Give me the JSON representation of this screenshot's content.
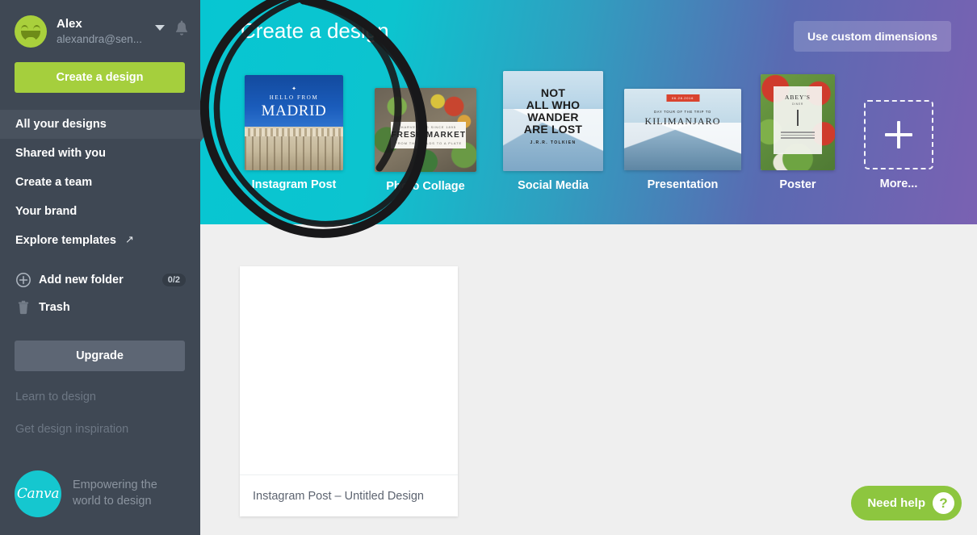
{
  "sidebar": {
    "account": {
      "name": "Alex",
      "email": "alexandra@sen...",
      "avatar_icon": "smiley-face-avatar",
      "caret_icon": "chevron-down-icon",
      "bell_icon": "bell-icon"
    },
    "create_design_label": "Create a design",
    "nav_items": [
      {
        "label": "All your designs",
        "active": true
      },
      {
        "label": "Shared with you",
        "active": false
      },
      {
        "label": "Create a team",
        "active": false
      },
      {
        "label": "Your brand",
        "active": false
      },
      {
        "label": "Explore templates",
        "active": false,
        "external_icon": "↗"
      }
    ],
    "folders": [
      {
        "label": "Add new folder",
        "icon": "plus-circle-icon",
        "badge": "0/2"
      },
      {
        "label": "Trash",
        "icon": "trash-icon",
        "badge": ""
      }
    ],
    "upgrade_label": "Upgrade",
    "faint_links": [
      {
        "label": "Learn to design"
      },
      {
        "label": "Get design inspiration"
      }
    ],
    "brand": {
      "logo_text": "Canva",
      "tagline_line1": "Empowering the",
      "tagline_line2": "world to design"
    }
  },
  "header": {
    "title": "Create a design",
    "custom_dimensions_label": "Use custom dimensions",
    "templates": [
      {
        "label": "Instagram Post",
        "art": "madrid"
      },
      {
        "label": "Photo Collage",
        "art": "fresh-market"
      },
      {
        "label": "Social Media",
        "art": "not-all-who-wander"
      },
      {
        "label": "Presentation",
        "art": "kilimanjaro"
      },
      {
        "label": "Poster",
        "art": "abeys"
      },
      {
        "label": "More...",
        "art": "more-plus"
      }
    ],
    "template_art_text": {
      "madrid": {
        "hello": "HELLO FROM",
        "title": "MADRID"
      },
      "fresh_market": {
        "top": "HARVESTING SINCE 1895",
        "title": "FRESH MARKET",
        "bottom": "FROM THE FIELDS TO A PLATE"
      },
      "wander": {
        "l1": "NOT",
        "l2": "ALL WHO",
        "l3": "WANDER",
        "l4": "ARE LOST",
        "by": "J.R.R. TOLKIEN"
      },
      "kilimanjaro": {
        "badge": "06.28.2016",
        "sub": "DAY TOUR OF THE TRIP TO",
        "title": "KILIMANJARO"
      },
      "abeys": {
        "title": "ABEY'S",
        "sub": "DINER"
      }
    }
  },
  "main": {
    "design_card_title": "Instagram Post – Untitled Design",
    "need_help_label": "Need help",
    "need_help_icon": "question-mark-icon"
  },
  "annotation": {
    "shape": "hand-drawn-circle",
    "color": "#1a1a1a"
  },
  "colors": {
    "sidebar_bg": "#3f4854",
    "sidebar_active": "#49525e",
    "accent_green": "#a5cf3d",
    "canva_teal": "#15c7cf",
    "header_gradient_start": "#07c6d2",
    "header_gradient_end": "#7a61b2",
    "main_bg": "#efefef",
    "help_green": "#8dc63f"
  }
}
